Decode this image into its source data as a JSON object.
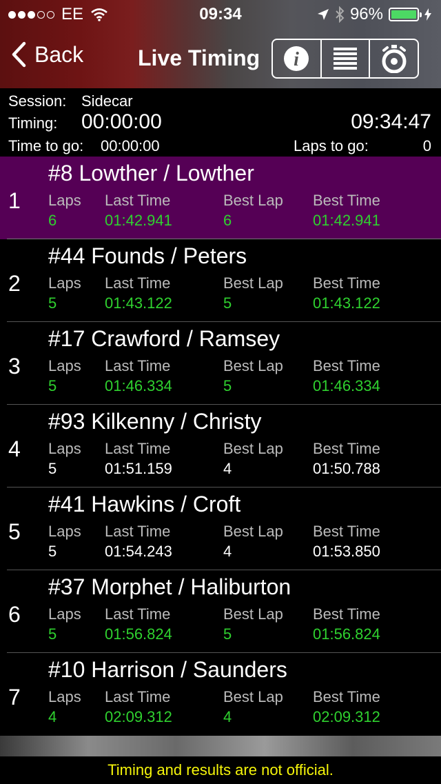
{
  "status_bar": {
    "carrier": "EE",
    "time": "09:34",
    "battery_pct": "96%",
    "signal_bars_filled": 3,
    "signal_bars_total": 5
  },
  "nav": {
    "back_label": "Back",
    "title": "Live Timing",
    "buttons": [
      "info-icon",
      "list-icon",
      "stopwatch-icon"
    ]
  },
  "session": {
    "session_label": "Session:",
    "session_value": "Sidecar",
    "timing_label": "Timing:",
    "timing_value": "00:00:00",
    "clock": "09:34:47",
    "time_to_go_label": "Time to go:",
    "time_to_go_value": "00:00:00",
    "laps_to_go_label": "Laps to go:",
    "laps_to_go_value": "0"
  },
  "columns": {
    "laps": "Laps",
    "last_time": "Last Time",
    "best_lap": "Best Lap",
    "best_time": "Best Time"
  },
  "entries": [
    {
      "pos": "1",
      "name": "#8 Lowther / Lowther",
      "laps": "6",
      "last_time": "01:42.941",
      "best_lap": "6",
      "best_time": "01:42.941"
    },
    {
      "pos": "2",
      "name": "#44 Founds / Peters",
      "laps": "5",
      "last_time": "01:43.122",
      "best_lap": "5",
      "best_time": "01:43.122"
    },
    {
      "pos": "3",
      "name": "#17 Crawford / Ramsey",
      "laps": "5",
      "last_time": "01:46.334",
      "best_lap": "5",
      "best_time": "01:46.334"
    },
    {
      "pos": "4",
      "name": "#93 Kilkenny / Christy",
      "laps": "5",
      "last_time": "01:51.159",
      "best_lap": "4",
      "best_time": "01:50.788"
    },
    {
      "pos": "5",
      "name": "#41 Hawkins / Croft",
      "laps": "5",
      "last_time": "01:54.243",
      "best_lap": "4",
      "best_time": "01:53.850"
    },
    {
      "pos": "6",
      "name": "#37 Morphet / Haliburton",
      "laps": "5",
      "last_time": "01:56.824",
      "best_lap": "5",
      "best_time": "01:56.824"
    },
    {
      "pos": "7",
      "name": "#10 Harrison / Saunders",
      "laps": "4",
      "last_time": "02:09.312",
      "best_lap": "4",
      "best_time": "02:09.312"
    }
  ],
  "footer": {
    "notice": "Timing and results are not official."
  },
  "colors": {
    "leader_bg": "#550055",
    "personal_best_green": "#2fd12f",
    "notice_yellow": "#f5f50a"
  }
}
